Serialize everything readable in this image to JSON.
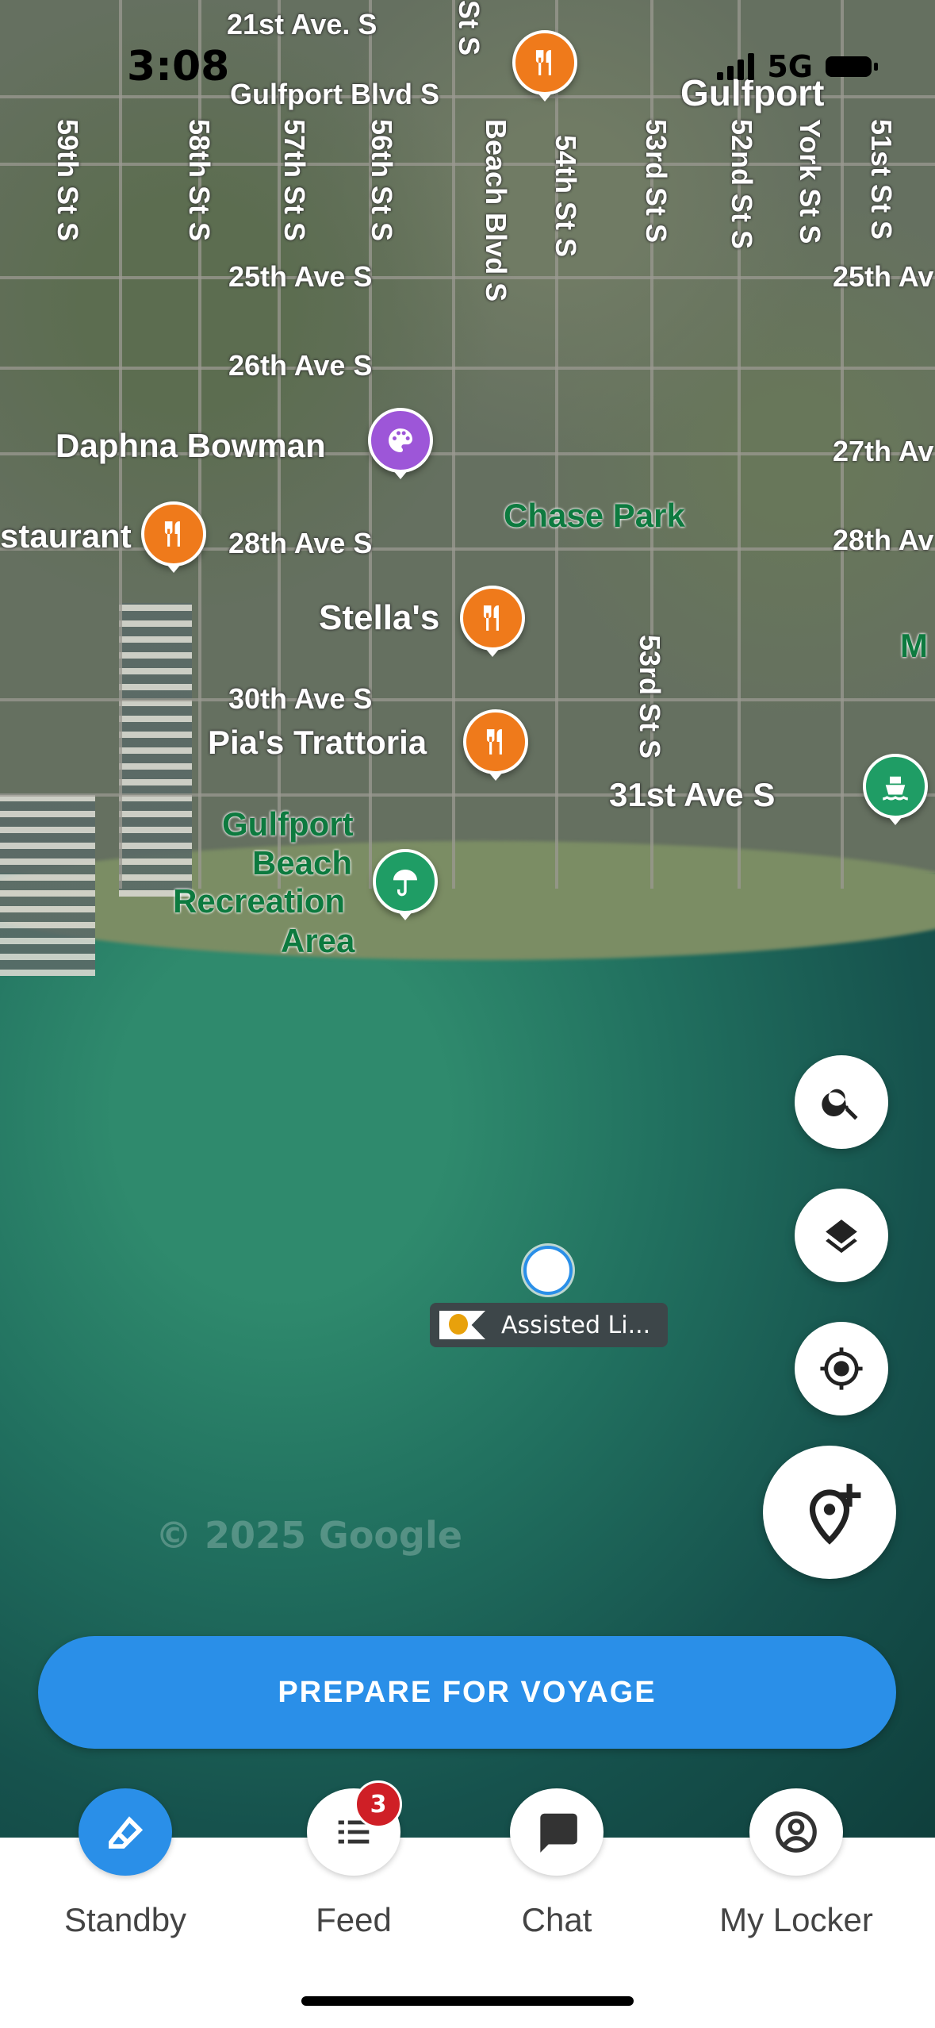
{
  "status_bar": {
    "time": "3:08",
    "network": "5G",
    "battery": "battery-icon"
  },
  "map": {
    "labels": {
      "street_21st": "21st Ave. S",
      "gulfport_blvd": "Gulfport Blvd S",
      "gulfport": "Gulfport",
      "st_s_top": "St S",
      "st_59": "59th St S",
      "st_58": "58th St S",
      "st_57": "57th St S",
      "st_56": "56th St S",
      "beach_blvd": "Beach Blvd S",
      "st_54": "54th St S",
      "st_53": "53rd St S",
      "st_52": "52nd St S",
      "york": "York St S",
      "st_51": "51st St S",
      "ave_25": "25th Ave S",
      "ave_25_right": "25th Av",
      "ave_26": "26th Ave S",
      "daphna": "Daphna Bowman",
      "ave_27_right": "27th Av",
      "restaurant": "staurant",
      "ave_28": "28th Ave S",
      "chase_park": "Chase Park",
      "ave_28_right": "28th Av",
      "stellas": "Stella's",
      "m_label": "M",
      "ave_30": "30th Ave S",
      "pias": "Pia's Trattoria",
      "st_53_lower": "53rd St S",
      "ave_31": "31st Ave S",
      "gulfport_beach": "Gulfport",
      "beach": "Beach",
      "recreation": "Recreation",
      "area": "Area"
    },
    "copyright": "© 2025 Google"
  },
  "vessel": {
    "label": "Assisted Li..."
  },
  "actions": {
    "search": "search-icon",
    "layers": "layers-icon",
    "locate": "target-icon",
    "add_pin": "add-location-icon",
    "prepare": "PREPARE FOR VOYAGE"
  },
  "nav": [
    {
      "label": "Standby",
      "icon": "boat-icon"
    },
    {
      "label": "Feed",
      "icon": "list-icon",
      "badge": "3"
    },
    {
      "label": "Chat",
      "icon": "chat-icon"
    },
    {
      "label": "My Locker",
      "icon": "account-circle-icon"
    }
  ],
  "colors": {
    "primary": "#2a8fe8",
    "badge": "#cf1f26",
    "orange_pin": "#ef7a1b",
    "purple_pin": "#9d56d8",
    "green_pin": "#1f9d65"
  }
}
